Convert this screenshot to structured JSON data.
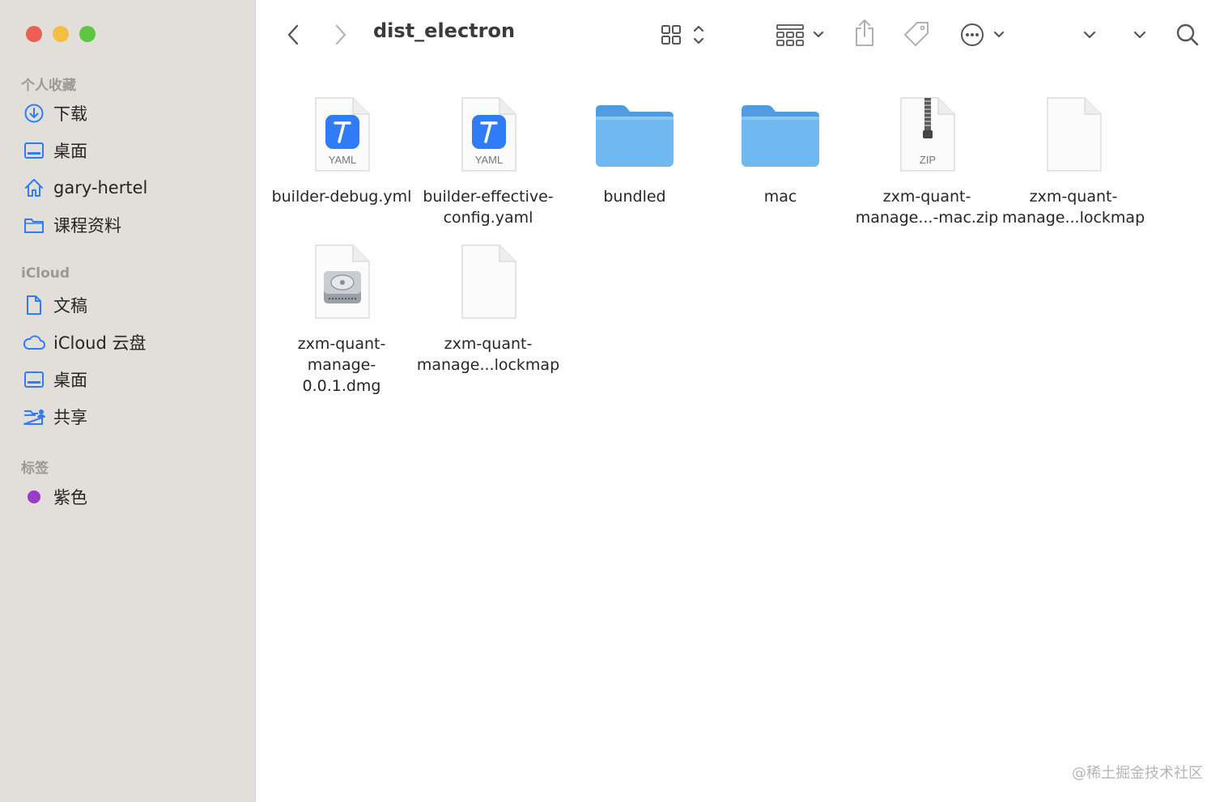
{
  "window": {
    "title": "dist_electron"
  },
  "sidebar": {
    "sections": [
      {
        "heading": "个人收藏",
        "items": [
          {
            "label": "下载",
            "icon": "download-icon"
          },
          {
            "label": "桌面",
            "icon": "desktop-icon"
          },
          {
            "label": "gary-hertel",
            "icon": "home-icon"
          },
          {
            "label": "课程资料",
            "icon": "folder-icon"
          }
        ]
      },
      {
        "heading": "iCloud",
        "items": [
          {
            "label": "文稿",
            "icon": "document-icon"
          },
          {
            "label": "iCloud 云盘",
            "icon": "cloud-icon"
          },
          {
            "label": "桌面",
            "icon": "desktop-icon"
          },
          {
            "label": "共享",
            "icon": "shared-folder-icon"
          }
        ]
      },
      {
        "heading": "标签",
        "items": [
          {
            "label": "紫色",
            "icon": "purple-tag-icon",
            "color": "#9a3cc6"
          }
        ]
      }
    ]
  },
  "files": [
    {
      "name": "builder-debug.yml",
      "kind": "yaml",
      "badge": "YAML"
    },
    {
      "name": "builder-effective-\nconfig.yaml",
      "kind": "yaml",
      "badge": "YAML"
    },
    {
      "name": "bundled",
      "kind": "folder"
    },
    {
      "name": "mac",
      "kind": "folder"
    },
    {
      "name": "zxm-quant-\nmanage...-mac.zip",
      "kind": "zip",
      "badge": "ZIP"
    },
    {
      "name": "zxm-quant-\nmanage...lockmap",
      "kind": "blank"
    },
    {
      "name": "zxm-quant-\nmanage-0.0.1.dmg",
      "kind": "dmg"
    },
    {
      "name": "zxm-quant-\nmanage...lockmap",
      "kind": "blank"
    }
  ],
  "watermark": "@稀土掘金技术社区",
  "colors": {
    "sidebar_bg": "#e2deda",
    "accent_blue": "#2f7cf6",
    "folder_blue": "#6fb8f0"
  }
}
